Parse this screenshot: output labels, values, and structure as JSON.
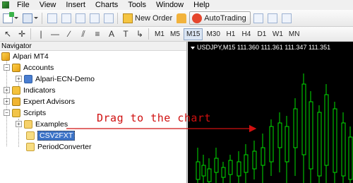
{
  "menubar": {
    "items": [
      "File",
      "View",
      "Insert",
      "Charts",
      "Tools",
      "Window",
      "Help"
    ]
  },
  "toolbar": {
    "new_order_label": "New Order",
    "autotrading_label": "AutoTrading"
  },
  "timeframes": {
    "items": [
      "M1",
      "M5",
      "M15",
      "M30",
      "H1",
      "H4",
      "D1",
      "W1",
      "MN"
    ],
    "active": "M15"
  },
  "navigator": {
    "title": "Navigator",
    "root": "Alpari MT4",
    "accounts": "Accounts",
    "account_item": "Alpari-ECN-Demo",
    "indicators": "Indicators",
    "expert_advisors": "Expert Advisors",
    "scripts": "Scripts",
    "examples": "Examples",
    "selected_script": "CSV2FXT",
    "period_converter": "PeriodConverter"
  },
  "chart": {
    "header": "USDJPY,M15  111.360 111.361 111.347 111.351"
  },
  "annotation": {
    "text": "Drag to the chart",
    "color": "#d01010"
  },
  "colors": {
    "chart_background": "#000000",
    "candle_color": "#00e000",
    "selection": "#3d74c8"
  }
}
